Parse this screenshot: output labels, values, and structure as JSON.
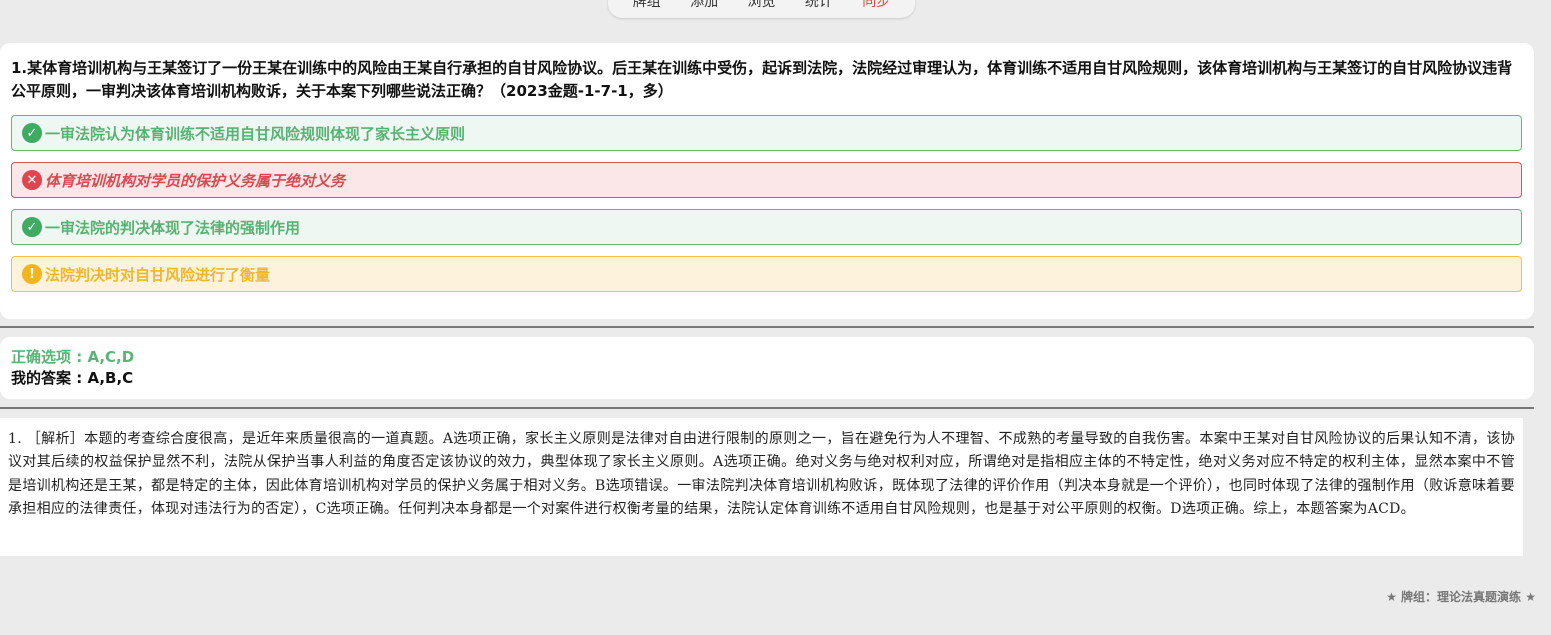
{
  "nav": {
    "items": [
      "牌组",
      "添加",
      "浏览",
      "统计",
      "同步"
    ],
    "active_color": "#e04a4a"
  },
  "question": {
    "text": "1.某体育培训机构与王某签订了一份王某在训练中的风险由王某自行承担的自甘风险协议。后王某在训练中受伤，起诉到法院，法院经过审理认为，体育训练不适用自甘风险规则，该体育培训机构与王某签订的自甘风险协议违背公平原则，一审判决该体育培训机构败诉，关于本案下列哪些说法正确？（2023金题-1-7-1，多）",
    "options": [
      {
        "text": "一审法院认为体育训练不适用自甘风险规则体现了家长主义原则",
        "status": "correct",
        "icon": "check-circle-icon"
      },
      {
        "text": "体育培训机构对学员的保护义务属于绝对义务",
        "status": "wrong",
        "icon": "x-circle-icon"
      },
      {
        "text": "一审法院的判决体现了法律的强制作用",
        "status": "correct",
        "icon": "check-circle-icon"
      },
      {
        "text": "法院判决时对自甘风险进行了衡量",
        "status": "missed",
        "icon": "exclamation-circle-icon"
      }
    ]
  },
  "answer": {
    "correct": "正确选项 : A,C,D",
    "mine": "我的答案 : A,B,C"
  },
  "explanation": "1. ［解析］本题的考查综合度很高，是近年来质量很高的一道真题。A选项正确，家长主义原则是法律对自由进行限制的原则之一，旨在避免行为人不理智、不成熟的考量导致的自我伤害。本案中王某对自甘风险协议的后果认知不清，该协议对其后续的权益保护显然不利，法院从保护当事人利益的角度否定该协议的效力，典型体现了家长主义原则。A选项正确。绝对义务与绝对权利对应，所谓绝对是指相应主体的不特定性，绝对义务对应不特定的权利主体，显然本案中不管是培训机构还是王某，都是特定的主体，因此体育培训机构对学员的保护义务属于相对义务。B选项错误。一审法院判决体育培训机构败诉，既体现了法律的评价作用（判决本身就是一个评价），也同时体现了法律的强制作用（败诉意味着要承担相应的法律责任，体现对违法行为的否定），C选项正确。任何判决本身都是一个对案件进行权衡考量的结果，法院认定体育训练不适用自甘风险规则，也是基于对公平原则的权衡。D选项正确。综上，本题答案为ACD。",
  "footer": "★ 牌组：理论法真题演练 ★"
}
